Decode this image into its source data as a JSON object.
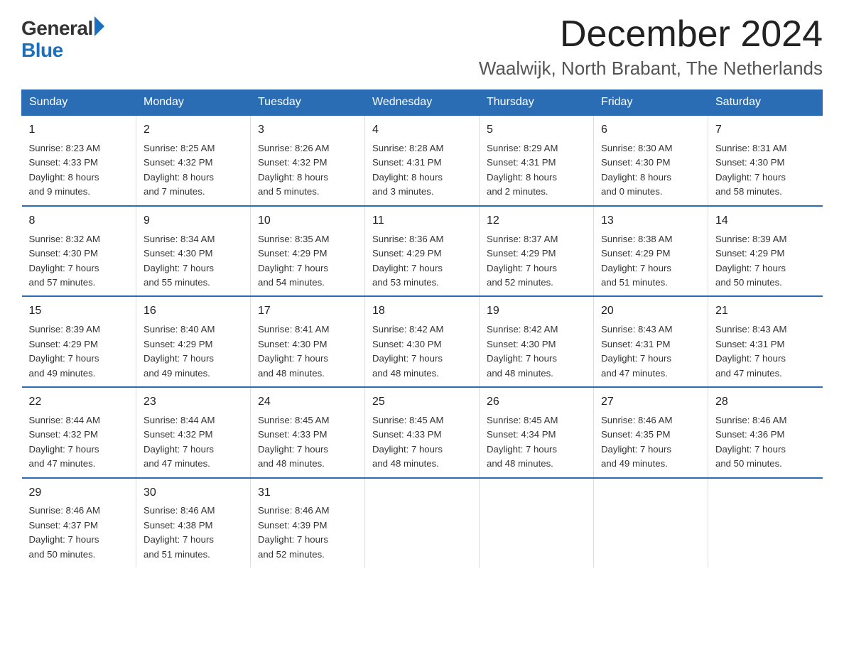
{
  "logo": {
    "general": "General",
    "blue": "Blue"
  },
  "title": "December 2024",
  "subtitle": "Waalwijk, North Brabant, The Netherlands",
  "weekdays": [
    "Sunday",
    "Monday",
    "Tuesday",
    "Wednesday",
    "Thursday",
    "Friday",
    "Saturday"
  ],
  "weeks": [
    [
      {
        "day": "1",
        "info": "Sunrise: 8:23 AM\nSunset: 4:33 PM\nDaylight: 8 hours\nand 9 minutes."
      },
      {
        "day": "2",
        "info": "Sunrise: 8:25 AM\nSunset: 4:32 PM\nDaylight: 8 hours\nand 7 minutes."
      },
      {
        "day": "3",
        "info": "Sunrise: 8:26 AM\nSunset: 4:32 PM\nDaylight: 8 hours\nand 5 minutes."
      },
      {
        "day": "4",
        "info": "Sunrise: 8:28 AM\nSunset: 4:31 PM\nDaylight: 8 hours\nand 3 minutes."
      },
      {
        "day": "5",
        "info": "Sunrise: 8:29 AM\nSunset: 4:31 PM\nDaylight: 8 hours\nand 2 minutes."
      },
      {
        "day": "6",
        "info": "Sunrise: 8:30 AM\nSunset: 4:30 PM\nDaylight: 8 hours\nand 0 minutes."
      },
      {
        "day": "7",
        "info": "Sunrise: 8:31 AM\nSunset: 4:30 PM\nDaylight: 7 hours\nand 58 minutes."
      }
    ],
    [
      {
        "day": "8",
        "info": "Sunrise: 8:32 AM\nSunset: 4:30 PM\nDaylight: 7 hours\nand 57 minutes."
      },
      {
        "day": "9",
        "info": "Sunrise: 8:34 AM\nSunset: 4:30 PM\nDaylight: 7 hours\nand 55 minutes."
      },
      {
        "day": "10",
        "info": "Sunrise: 8:35 AM\nSunset: 4:29 PM\nDaylight: 7 hours\nand 54 minutes."
      },
      {
        "day": "11",
        "info": "Sunrise: 8:36 AM\nSunset: 4:29 PM\nDaylight: 7 hours\nand 53 minutes."
      },
      {
        "day": "12",
        "info": "Sunrise: 8:37 AM\nSunset: 4:29 PM\nDaylight: 7 hours\nand 52 minutes."
      },
      {
        "day": "13",
        "info": "Sunrise: 8:38 AM\nSunset: 4:29 PM\nDaylight: 7 hours\nand 51 minutes."
      },
      {
        "day": "14",
        "info": "Sunrise: 8:39 AM\nSunset: 4:29 PM\nDaylight: 7 hours\nand 50 minutes."
      }
    ],
    [
      {
        "day": "15",
        "info": "Sunrise: 8:39 AM\nSunset: 4:29 PM\nDaylight: 7 hours\nand 49 minutes."
      },
      {
        "day": "16",
        "info": "Sunrise: 8:40 AM\nSunset: 4:29 PM\nDaylight: 7 hours\nand 49 minutes."
      },
      {
        "day": "17",
        "info": "Sunrise: 8:41 AM\nSunset: 4:30 PM\nDaylight: 7 hours\nand 48 minutes."
      },
      {
        "day": "18",
        "info": "Sunrise: 8:42 AM\nSunset: 4:30 PM\nDaylight: 7 hours\nand 48 minutes."
      },
      {
        "day": "19",
        "info": "Sunrise: 8:42 AM\nSunset: 4:30 PM\nDaylight: 7 hours\nand 48 minutes."
      },
      {
        "day": "20",
        "info": "Sunrise: 8:43 AM\nSunset: 4:31 PM\nDaylight: 7 hours\nand 47 minutes."
      },
      {
        "day": "21",
        "info": "Sunrise: 8:43 AM\nSunset: 4:31 PM\nDaylight: 7 hours\nand 47 minutes."
      }
    ],
    [
      {
        "day": "22",
        "info": "Sunrise: 8:44 AM\nSunset: 4:32 PM\nDaylight: 7 hours\nand 47 minutes."
      },
      {
        "day": "23",
        "info": "Sunrise: 8:44 AM\nSunset: 4:32 PM\nDaylight: 7 hours\nand 47 minutes."
      },
      {
        "day": "24",
        "info": "Sunrise: 8:45 AM\nSunset: 4:33 PM\nDaylight: 7 hours\nand 48 minutes."
      },
      {
        "day": "25",
        "info": "Sunrise: 8:45 AM\nSunset: 4:33 PM\nDaylight: 7 hours\nand 48 minutes."
      },
      {
        "day": "26",
        "info": "Sunrise: 8:45 AM\nSunset: 4:34 PM\nDaylight: 7 hours\nand 48 minutes."
      },
      {
        "day": "27",
        "info": "Sunrise: 8:46 AM\nSunset: 4:35 PM\nDaylight: 7 hours\nand 49 minutes."
      },
      {
        "day": "28",
        "info": "Sunrise: 8:46 AM\nSunset: 4:36 PM\nDaylight: 7 hours\nand 50 minutes."
      }
    ],
    [
      {
        "day": "29",
        "info": "Sunrise: 8:46 AM\nSunset: 4:37 PM\nDaylight: 7 hours\nand 50 minutes."
      },
      {
        "day": "30",
        "info": "Sunrise: 8:46 AM\nSunset: 4:38 PM\nDaylight: 7 hours\nand 51 minutes."
      },
      {
        "day": "31",
        "info": "Sunrise: 8:46 AM\nSunset: 4:39 PM\nDaylight: 7 hours\nand 52 minutes."
      },
      {
        "day": "",
        "info": ""
      },
      {
        "day": "",
        "info": ""
      },
      {
        "day": "",
        "info": ""
      },
      {
        "day": "",
        "info": ""
      }
    ]
  ],
  "colors": {
    "header_bg": "#2a6db5",
    "header_text": "#ffffff",
    "border": "#2a6db5"
  }
}
